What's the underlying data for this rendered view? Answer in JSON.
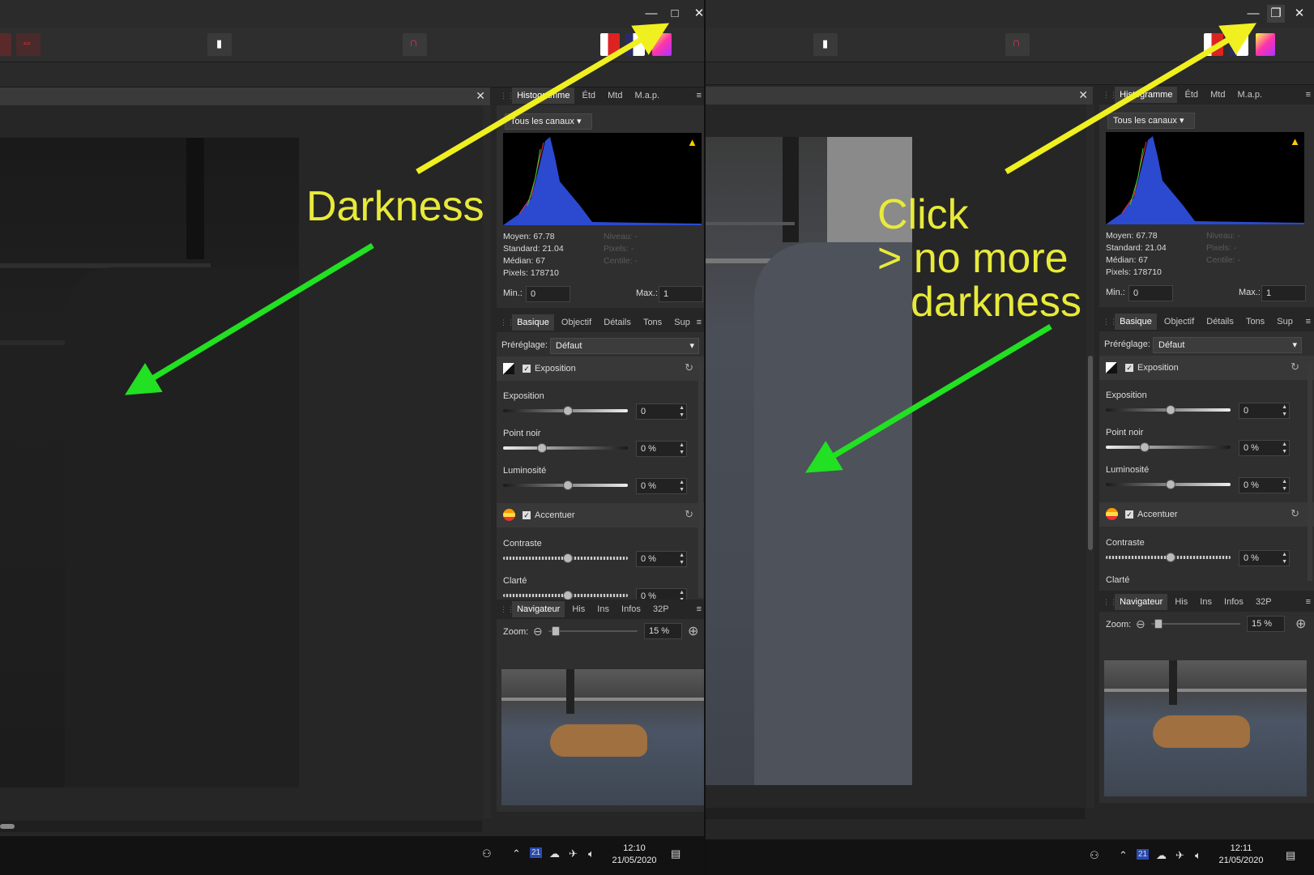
{
  "annotations": {
    "left": "Darkness",
    "right_line1": "Click",
    "right_line2": "> no more",
    "right_line3": "darkness"
  },
  "colors": {
    "annotation_text": "#e8ea3a",
    "arrow_yellow": "#f0f020",
    "arrow_green": "#22e022"
  },
  "window_controls": {
    "minimize": "—",
    "maximize": "□",
    "restore": "❐",
    "close": "✕"
  },
  "icons": [
    "minimize-icon",
    "maximize-icon",
    "restore-icon",
    "close-icon",
    "histogram-warning-icon",
    "reset-icon",
    "zoom-out-icon",
    "zoom-in-icon",
    "people-icon",
    "chevron-up-icon",
    "cloud-icon",
    "network-icon",
    "volume-icon",
    "notification-icon"
  ],
  "histogram_panel": {
    "tabs": [
      "Histogramme",
      "Étd",
      "Mtd",
      "M.a.p."
    ],
    "channel_select": "Tous les canaux",
    "stats": {
      "moyen": "Moyen: 67.78",
      "standard": "Standard: 21.04",
      "median": "Médian: 67",
      "pixels": "Pixels: 178710"
    },
    "stats_dim": {
      "niveau": "Niveau: -",
      "pixels": "Pixels: -",
      "centile": "Centile: -"
    },
    "min_label": "Min.:",
    "min_value": "0",
    "max_label": "Max.:",
    "max_value": "1"
  },
  "develop_panel": {
    "tabs": [
      "Basique",
      "Objectif",
      "Détails",
      "Tons",
      "Sup"
    ],
    "preset_label": "Préréglage:",
    "preset_value": "Défaut",
    "exposition_section": "Exposition",
    "accentuer_section": "Accentuer",
    "sliders": {
      "exposition": {
        "label": "Exposition",
        "value": "0"
      },
      "point_noir": {
        "label": "Point noir",
        "value": "0 %"
      },
      "luminosite": {
        "label": "Luminosité",
        "value": "0 %"
      },
      "contraste": {
        "label": "Contraste",
        "value": "0 %"
      },
      "clarte": {
        "label": "Clarté",
        "value": "0 %"
      }
    }
  },
  "navigator_panel": {
    "tabs": [
      "Navigateur",
      "His",
      "Ins",
      "Infos",
      "32P"
    ],
    "zoom_label": "Zoom:",
    "zoom_value": "15 %"
  },
  "taskbar_left": {
    "time": "12:10",
    "date": "21/05/2020",
    "calendar_day": "21"
  },
  "taskbar_right": {
    "time": "12:11",
    "date": "21/05/2020",
    "calendar_day": "21"
  }
}
